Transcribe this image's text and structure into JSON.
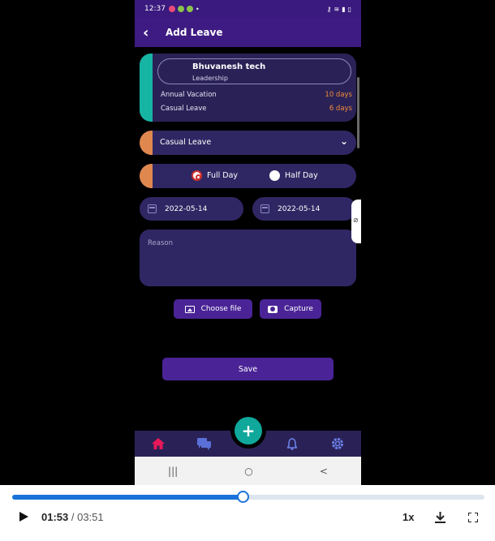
{
  "status_bar": {
    "time": "12:37"
  },
  "app_bar": {
    "title": "Add Leave"
  },
  "employee": {
    "name": "Bhuvanesh tech",
    "role": "Leadership",
    "balances": [
      {
        "label": "Annual Vacation",
        "value": "10 days"
      },
      {
        "label": "Casual Leave",
        "value": "6 days"
      }
    ]
  },
  "form": {
    "leave_type": "Casual Leave",
    "day_options": {
      "full": "Full Day",
      "half": "Half Day",
      "selected": "full"
    },
    "from_date": "2022-05-14",
    "to_date": "2022-05-14",
    "reason_placeholder": "Reason",
    "choose_file_label": "Choose file",
    "capture_label": "Capture",
    "save_label": "Save"
  },
  "colors": {
    "accent_teal": "#16b5a3",
    "accent_orange": "#e0874f",
    "primary_purple": "#4a2496",
    "home_active": "#e8185a"
  },
  "video": {
    "current_time": "01:53",
    "separator": " / ",
    "duration": "03:51",
    "speed": "1x",
    "progress": 0.488
  }
}
